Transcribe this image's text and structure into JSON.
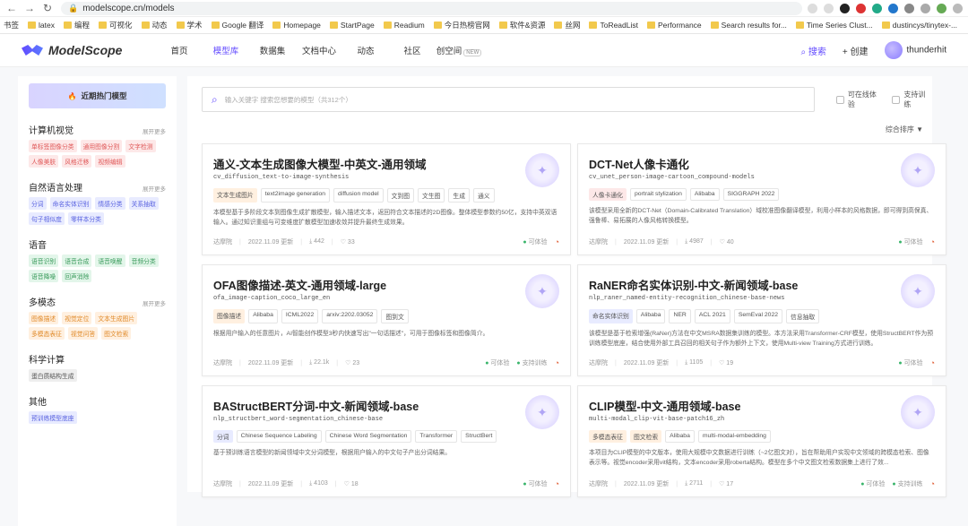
{
  "browser": {
    "url": "modelscope.cn/models"
  },
  "bookmarks": [
    {
      "label": "书签"
    },
    {
      "label": "latex"
    },
    {
      "label": "编程"
    },
    {
      "label": "可视化"
    },
    {
      "label": "动态"
    },
    {
      "label": "学术"
    },
    {
      "label": "Google 翻译"
    },
    {
      "label": "Homepage"
    },
    {
      "label": "StartPage"
    },
    {
      "label": "Readium"
    },
    {
      "label": "今日热榜官网"
    },
    {
      "label": "软件&资源"
    },
    {
      "label": "丝网"
    },
    {
      "label": "ToReadList"
    },
    {
      "label": "Performance"
    },
    {
      "label": "Search results for..."
    },
    {
      "label": "Time Series Clust..."
    },
    {
      "label": "dustincys/tinytex-..."
    }
  ],
  "nav": {
    "logo": "ModelScope",
    "items": [
      {
        "label": "首页"
      },
      {
        "label": "模型库"
      },
      {
        "label": "数据集"
      },
      {
        "label": "文档中心"
      },
      {
        "label": "动态"
      },
      {
        "label": "社区"
      },
      {
        "label": "创空间"
      }
    ],
    "new_badge": "NEW",
    "search": "搜索",
    "create": "+ 创建",
    "user": "thunderhit"
  },
  "sidebar": {
    "hot_button": "近期热门模型",
    "categories": [
      {
        "title": "计算机视觉",
        "more": "展开更多",
        "tags": [
          {
            "t": "单标签图像分类",
            "c": "red"
          },
          {
            "t": "通用图像分割",
            "c": "red"
          },
          {
            "t": "文字检测",
            "c": "red"
          },
          {
            "t": "人像美肤",
            "c": "red"
          },
          {
            "t": "风格迁移",
            "c": "red"
          },
          {
            "t": "视频编辑",
            "c": "red"
          }
        ]
      },
      {
        "title": "自然语言处理",
        "more": "展开更多",
        "tags": [
          {
            "t": "分词",
            "c": "blue"
          },
          {
            "t": "命名实体识别",
            "c": "blue"
          },
          {
            "t": "情感分类",
            "c": "blue"
          },
          {
            "t": "关系抽取",
            "c": "blue"
          },
          {
            "t": "句子相似度",
            "c": "blue"
          },
          {
            "t": "零样本分类",
            "c": "blue"
          }
        ]
      },
      {
        "title": "语音",
        "more": "",
        "tags": [
          {
            "t": "语音识别",
            "c": "green"
          },
          {
            "t": "语音合成",
            "c": "green"
          },
          {
            "t": "语音唤醒",
            "c": "green"
          },
          {
            "t": "音频分类",
            "c": "green"
          },
          {
            "t": "语音降噪",
            "c": "green"
          },
          {
            "t": "回声消除",
            "c": "green"
          }
        ]
      },
      {
        "title": "多模态",
        "more": "展开更多",
        "tags": [
          {
            "t": "图像描述",
            "c": "orange"
          },
          {
            "t": "视觉定位",
            "c": "orange"
          },
          {
            "t": "文本生成图片",
            "c": "orange"
          },
          {
            "t": "多模态表征",
            "c": "orange"
          },
          {
            "t": "视觉问答",
            "c": "orange"
          },
          {
            "t": "图文检索",
            "c": "orange"
          }
        ]
      },
      {
        "title": "科学计算",
        "more": "",
        "tags": [
          {
            "t": "蛋白质结构生成",
            "c": "gray"
          }
        ]
      },
      {
        "title": "其他",
        "more": "",
        "tags": [
          {
            "t": "预训练模型底座",
            "c": "blue"
          }
        ]
      }
    ]
  },
  "main": {
    "search_placeholder": "输入关键字 搜索您想要的模型（共312个）",
    "check_online": "可在线体验",
    "check_train": "支持训练",
    "sort": "综合排序 ▼",
    "cards": [
      {
        "title": "通义-文本生成图像大模型-中英文-通用领域",
        "id": "cv_diffusion_text-to-image-synthesis",
        "tags": [
          {
            "t": "文本生成图片",
            "hl": "orange"
          },
          {
            "t": "text2image generation"
          },
          {
            "t": "diffusion model"
          },
          {
            "t": "文到图"
          },
          {
            "t": "文生图"
          },
          {
            "t": "生成"
          },
          {
            "t": "通义"
          }
        ],
        "desc": "本模型基于多阶段文本到图像生成扩散模型，输入描述文本，返回符合文本描述的2D图像。整体模型参数约50亿，支持中英双语输入。通过知识重组与可变维度扩散模型加速收敛并提升最终生成效果。",
        "org": "达摩院",
        "date": "2022.11.09 更新",
        "downloads": "442",
        "stars": "33",
        "online": "可体验",
        "train": ""
      },
      {
        "title": "DCT-Net人像卡通化",
        "id": "cv_unet_person-image-cartoon_compound-models",
        "tags": [
          {
            "t": "人像卡通化",
            "hl": "red"
          },
          {
            "t": "portrait stylization"
          },
          {
            "t": "Alibaba"
          },
          {
            "t": "SIGGRAPH 2022"
          }
        ],
        "desc": "该模型采用全新的DCT-Net（Domain-Calibrated Translation）域校准图像翻译模型，利用小样本的风格数据，即可得到高保真、强鲁棒、易拓展的人像风格转换模型。",
        "org": "达摩院",
        "date": "2022.11.09 更新",
        "downloads": "4987",
        "stars": "40",
        "online": "可体验",
        "train": ""
      },
      {
        "title": "OFA图像描述-英文-通用领域-large",
        "id": "ofa_image-caption_coco_large_en",
        "tags": [
          {
            "t": "图像描述",
            "hl": "orange"
          },
          {
            "t": "Alibaba"
          },
          {
            "t": "ICML2022"
          },
          {
            "t": "arxiv:2202.03052"
          },
          {
            "t": "图到文"
          }
        ],
        "desc": "根据用户输入的任意图片，AI智能创作模型3秒内快速写出\"一句话描述\"，可用于图像标签和图像简介。",
        "org": "达摩院",
        "date": "2022.11.09 更新",
        "downloads": "22.1k",
        "stars": "23",
        "online": "可体验",
        "train": "支持训练"
      },
      {
        "title": "RaNER命名实体识别-中文-新闻领域-base",
        "id": "nlp_raner_named-entity-recognition_chinese-base-news",
        "tags": [
          {
            "t": "命名实体识别",
            "hl": "blue"
          },
          {
            "t": "Alibaba"
          },
          {
            "t": "NER"
          },
          {
            "t": "ACL 2021"
          },
          {
            "t": "SemEval 2022"
          },
          {
            "t": "信息抽取"
          }
        ],
        "desc": "该模型是基于检索增强(RaNer)方法在中文MSRA数据集训练的模型。本方法采用Transformer-CRF模型，使用StructBERT作为预训练模型底座，结合使用外部工具召回的相关句子作为额外上下文，使用Multi-view Training方式进行训练。",
        "org": "达摩院",
        "date": "2022.11.09 更新",
        "downloads": "1105",
        "stars": "19",
        "online": "可体验",
        "train": ""
      },
      {
        "title": "BAStructBERT分词-中文-新闻领域-base",
        "id": "nlp_structbert_word-segmentation_chinese-base",
        "tags": [
          {
            "t": "分词",
            "hl": "blue"
          },
          {
            "t": "Chinese Sequence Labeling"
          },
          {
            "t": "Chinese Word Segmentation"
          },
          {
            "t": "Transformer"
          },
          {
            "t": "StructBert"
          }
        ],
        "desc": "基于预训练语言模型的新闻领域中文分词模型，根据用户输入的中文句子产出分词结果。",
        "org": "达摩院",
        "date": "2022.11.09 更新",
        "downloads": "4103",
        "stars": "18",
        "online": "可体验",
        "train": ""
      },
      {
        "title": "CLIP模型-中文-通用领域-base",
        "id": "multi-modal_clip-vit-base-patch16_zh",
        "tags": [
          {
            "t": "多模态表征",
            "hl": "orange"
          },
          {
            "t": "图文检索",
            "hl": "orange"
          },
          {
            "t": "Alibaba"
          },
          {
            "t": "multi-modal-embedding"
          }
        ],
        "desc": "本项目为CLIP模型的中文版本，使用大规模中文数据进行训练（~2亿图文对），旨在帮助用户实现中文领域的跨模态检索、图像表示等。视觉encoder采用vit结构，文本encoder采用roberta结构。模型在多个中文图文检索数据集上进行了效...",
        "org": "达摩院",
        "date": "2022.11.09 更新",
        "downloads": "2711",
        "stars": "17",
        "online": "可体验",
        "train": "支持训练"
      }
    ]
  }
}
